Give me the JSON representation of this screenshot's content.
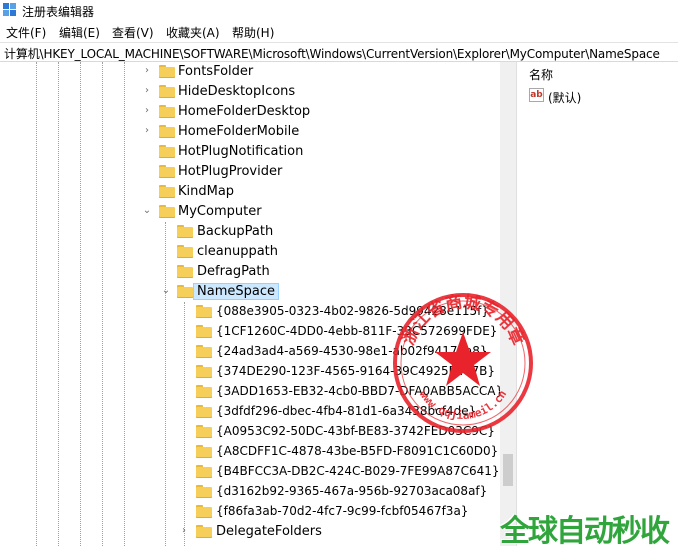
{
  "window": {
    "title": "注册表编辑器"
  },
  "menu": [
    "文件(F)",
    "编辑(E)",
    "查看(V)",
    "收藏夹(A)",
    "帮助(H)"
  ],
  "address": "计算机\\HKEY_LOCAL_MACHINE\\SOFTWARE\\Microsoft\\Windows\\CurrentVersion\\Explorer\\MyComputer\\NameSpace",
  "tree": [
    {
      "label": "FontsFolder",
      "level": 0,
      "expander": "collapsed"
    },
    {
      "label": "HideDesktopIcons",
      "level": 0,
      "expander": "collapsed"
    },
    {
      "label": "HomeFolderDesktop",
      "level": 0,
      "expander": "collapsed"
    },
    {
      "label": "HomeFolderMobile",
      "level": 0,
      "expander": "collapsed"
    },
    {
      "label": "HotPlugNotification",
      "level": 0,
      "expander": "none"
    },
    {
      "label": "HotPlugProvider",
      "level": 0,
      "expander": "none"
    },
    {
      "label": "KindMap",
      "level": 0,
      "expander": "none"
    },
    {
      "label": "MyComputer",
      "level": 0,
      "expander": "expanded"
    },
    {
      "label": "BackupPath",
      "level": 1,
      "expander": "none"
    },
    {
      "label": "cleanuppath",
      "level": 1,
      "expander": "none"
    },
    {
      "label": "DefragPath",
      "level": 1,
      "expander": "none"
    },
    {
      "label": "NameSpace",
      "level": 1,
      "expander": "expanded",
      "selected": true
    },
    {
      "label": "{088e3905-0323-4b02-9826-5d99428e115f}",
      "level": 2,
      "expander": "none"
    },
    {
      "label": "{1CF1260C-4DD0-4ebb-811F-33C572699FDE}",
      "level": 2,
      "expander": "none"
    },
    {
      "label": "{24ad3ad4-a569-4530-98e1-ab02f9417aa8}",
      "level": 2,
      "expander": "none"
    },
    {
      "label": "{374DE290-123F-4565-9164-39C4925E467B}",
      "level": 2,
      "expander": "none"
    },
    {
      "label": "{3ADD1653-EB32-4cb0-BBD7-DFA0ABB5ACCA}",
      "level": 2,
      "expander": "none"
    },
    {
      "label": "{3dfdf296-dbec-4fb4-81d1-6a3438bcf4de}",
      "level": 2,
      "expander": "none"
    },
    {
      "label": "{A0953C92-50DC-43bf-BE83-3742FED03C9C}",
      "level": 2,
      "expander": "none"
    },
    {
      "label": "{A8CDFF1C-4878-43be-B5FD-F8091C1C60D0}",
      "level": 2,
      "expander": "none"
    },
    {
      "label": "{B4BFCC3A-DB2C-424C-B029-7FE99A87C641}",
      "level": 2,
      "expander": "none"
    },
    {
      "label": "{d3162b92-9365-467a-956b-92703aca08af}",
      "level": 2,
      "expander": "none"
    },
    {
      "label": "{f86fa3ab-70d2-4fc7-9c99-fcbf05467f3a}",
      "level": 2,
      "expander": "none"
    },
    {
      "label": "DelegateFolders",
      "level": 2,
      "expander": "collapsed"
    }
  ],
  "right": {
    "column_name": "名称",
    "default_value_label": "(默认)",
    "value_icon": "ab"
  },
  "stamp": {
    "text": "浙江省商城专用章",
    "url": "www.qqjiameil.cn",
    "color": "#e8232b"
  },
  "watermark": "全球自动秒收",
  "colors": {
    "selection_bg": "#cce8ff",
    "folder": "#f6cf5b",
    "stamp_red": "#e8232b",
    "watermark_green": "#2fa53c"
  }
}
